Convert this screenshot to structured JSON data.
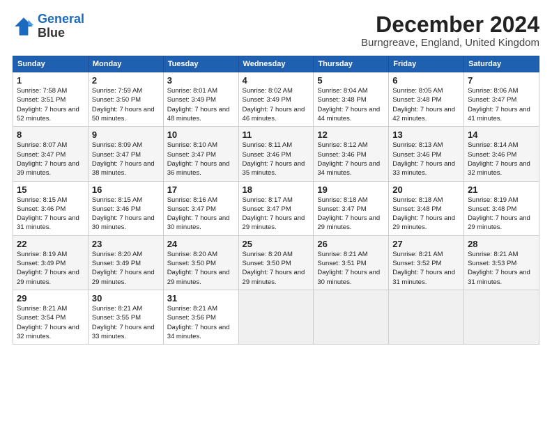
{
  "logo": {
    "line1": "General",
    "line2": "Blue"
  },
  "title": "December 2024",
  "subtitle": "Burngreave, England, United Kingdom",
  "headers": [
    "Sunday",
    "Monday",
    "Tuesday",
    "Wednesday",
    "Thursday",
    "Friday",
    "Saturday"
  ],
  "weeks": [
    [
      {
        "day": "1",
        "rise": "Sunrise: 7:58 AM",
        "set": "Sunset: 3:51 PM",
        "daylight": "Daylight: 7 hours and 52 minutes."
      },
      {
        "day": "2",
        "rise": "Sunrise: 7:59 AM",
        "set": "Sunset: 3:50 PM",
        "daylight": "Daylight: 7 hours and 50 minutes."
      },
      {
        "day": "3",
        "rise": "Sunrise: 8:01 AM",
        "set": "Sunset: 3:49 PM",
        "daylight": "Daylight: 7 hours and 48 minutes."
      },
      {
        "day": "4",
        "rise": "Sunrise: 8:02 AM",
        "set": "Sunset: 3:49 PM",
        "daylight": "Daylight: 7 hours and 46 minutes."
      },
      {
        "day": "5",
        "rise": "Sunrise: 8:04 AM",
        "set": "Sunset: 3:48 PM",
        "daylight": "Daylight: 7 hours and 44 minutes."
      },
      {
        "day": "6",
        "rise": "Sunrise: 8:05 AM",
        "set": "Sunset: 3:48 PM",
        "daylight": "Daylight: 7 hours and 42 minutes."
      },
      {
        "day": "7",
        "rise": "Sunrise: 8:06 AM",
        "set": "Sunset: 3:47 PM",
        "daylight": "Daylight: 7 hours and 41 minutes."
      }
    ],
    [
      {
        "day": "8",
        "rise": "Sunrise: 8:07 AM",
        "set": "Sunset: 3:47 PM",
        "daylight": "Daylight: 7 hours and 39 minutes."
      },
      {
        "day": "9",
        "rise": "Sunrise: 8:09 AM",
        "set": "Sunset: 3:47 PM",
        "daylight": "Daylight: 7 hours and 38 minutes."
      },
      {
        "day": "10",
        "rise": "Sunrise: 8:10 AM",
        "set": "Sunset: 3:47 PM",
        "daylight": "Daylight: 7 hours and 36 minutes."
      },
      {
        "day": "11",
        "rise": "Sunrise: 8:11 AM",
        "set": "Sunset: 3:46 PM",
        "daylight": "Daylight: 7 hours and 35 minutes."
      },
      {
        "day": "12",
        "rise": "Sunrise: 8:12 AM",
        "set": "Sunset: 3:46 PM",
        "daylight": "Daylight: 7 hours and 34 minutes."
      },
      {
        "day": "13",
        "rise": "Sunrise: 8:13 AM",
        "set": "Sunset: 3:46 PM",
        "daylight": "Daylight: 7 hours and 33 minutes."
      },
      {
        "day": "14",
        "rise": "Sunrise: 8:14 AM",
        "set": "Sunset: 3:46 PM",
        "daylight": "Daylight: 7 hours and 32 minutes."
      }
    ],
    [
      {
        "day": "15",
        "rise": "Sunrise: 8:15 AM",
        "set": "Sunset: 3:46 PM",
        "daylight": "Daylight: 7 hours and 31 minutes."
      },
      {
        "day": "16",
        "rise": "Sunrise: 8:15 AM",
        "set": "Sunset: 3:46 PM",
        "daylight": "Daylight: 7 hours and 30 minutes."
      },
      {
        "day": "17",
        "rise": "Sunrise: 8:16 AM",
        "set": "Sunset: 3:47 PM",
        "daylight": "Daylight: 7 hours and 30 minutes."
      },
      {
        "day": "18",
        "rise": "Sunrise: 8:17 AM",
        "set": "Sunset: 3:47 PM",
        "daylight": "Daylight: 7 hours and 29 minutes."
      },
      {
        "day": "19",
        "rise": "Sunrise: 8:18 AM",
        "set": "Sunset: 3:47 PM",
        "daylight": "Daylight: 7 hours and 29 minutes."
      },
      {
        "day": "20",
        "rise": "Sunrise: 8:18 AM",
        "set": "Sunset: 3:48 PM",
        "daylight": "Daylight: 7 hours and 29 minutes."
      },
      {
        "day": "21",
        "rise": "Sunrise: 8:19 AM",
        "set": "Sunset: 3:48 PM",
        "daylight": "Daylight: 7 hours and 29 minutes."
      }
    ],
    [
      {
        "day": "22",
        "rise": "Sunrise: 8:19 AM",
        "set": "Sunset: 3:49 PM",
        "daylight": "Daylight: 7 hours and 29 minutes."
      },
      {
        "day": "23",
        "rise": "Sunrise: 8:20 AM",
        "set": "Sunset: 3:49 PM",
        "daylight": "Daylight: 7 hours and 29 minutes."
      },
      {
        "day": "24",
        "rise": "Sunrise: 8:20 AM",
        "set": "Sunset: 3:50 PM",
        "daylight": "Daylight: 7 hours and 29 minutes."
      },
      {
        "day": "25",
        "rise": "Sunrise: 8:20 AM",
        "set": "Sunset: 3:50 PM",
        "daylight": "Daylight: 7 hours and 29 minutes."
      },
      {
        "day": "26",
        "rise": "Sunrise: 8:21 AM",
        "set": "Sunset: 3:51 PM",
        "daylight": "Daylight: 7 hours and 30 minutes."
      },
      {
        "day": "27",
        "rise": "Sunrise: 8:21 AM",
        "set": "Sunset: 3:52 PM",
        "daylight": "Daylight: 7 hours and 31 minutes."
      },
      {
        "day": "28",
        "rise": "Sunrise: 8:21 AM",
        "set": "Sunset: 3:53 PM",
        "daylight": "Daylight: 7 hours and 31 minutes."
      }
    ],
    [
      {
        "day": "29",
        "rise": "Sunrise: 8:21 AM",
        "set": "Sunset: 3:54 PM",
        "daylight": "Daylight: 7 hours and 32 minutes."
      },
      {
        "day": "30",
        "rise": "Sunrise: 8:21 AM",
        "set": "Sunset: 3:55 PM",
        "daylight": "Daylight: 7 hours and 33 minutes."
      },
      {
        "day": "31",
        "rise": "Sunrise: 8:21 AM",
        "set": "Sunset: 3:56 PM",
        "daylight": "Daylight: 7 hours and 34 minutes."
      },
      null,
      null,
      null,
      null
    ]
  ]
}
